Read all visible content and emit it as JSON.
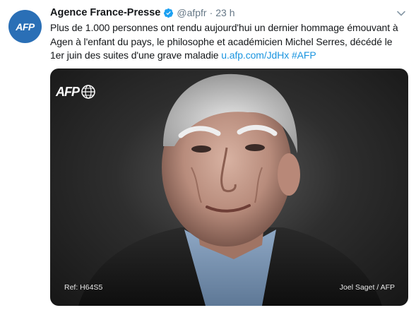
{
  "author": {
    "name": "Agence France-Presse",
    "handle": "@afpfr",
    "separator": "·",
    "time": "23 h",
    "avatar_text": "AFP"
  },
  "tweet": {
    "text": "Plus de 1.000 personnes ont rendu aujourd'hui un dernier hommage émouvant à Agen à l'enfant du pays, le philosophe et académicien Michel Serres, décédé le 1er juin des suites d'une grave maladie",
    "link": "u.afp.com/JdHx",
    "hashtag": "#AFP"
  },
  "media": {
    "logo_text": "AFP",
    "ref": "Ref: H64S5",
    "credit": "Joel Saget / AFP"
  },
  "colors": {
    "link": "#1b95e0",
    "verified": "#1da1f2",
    "avatar_bg": "#2a6fb6",
    "muted": "#657786"
  },
  "icons": {
    "verified": "verified-badge-icon",
    "caret": "chevron-down-icon"
  }
}
